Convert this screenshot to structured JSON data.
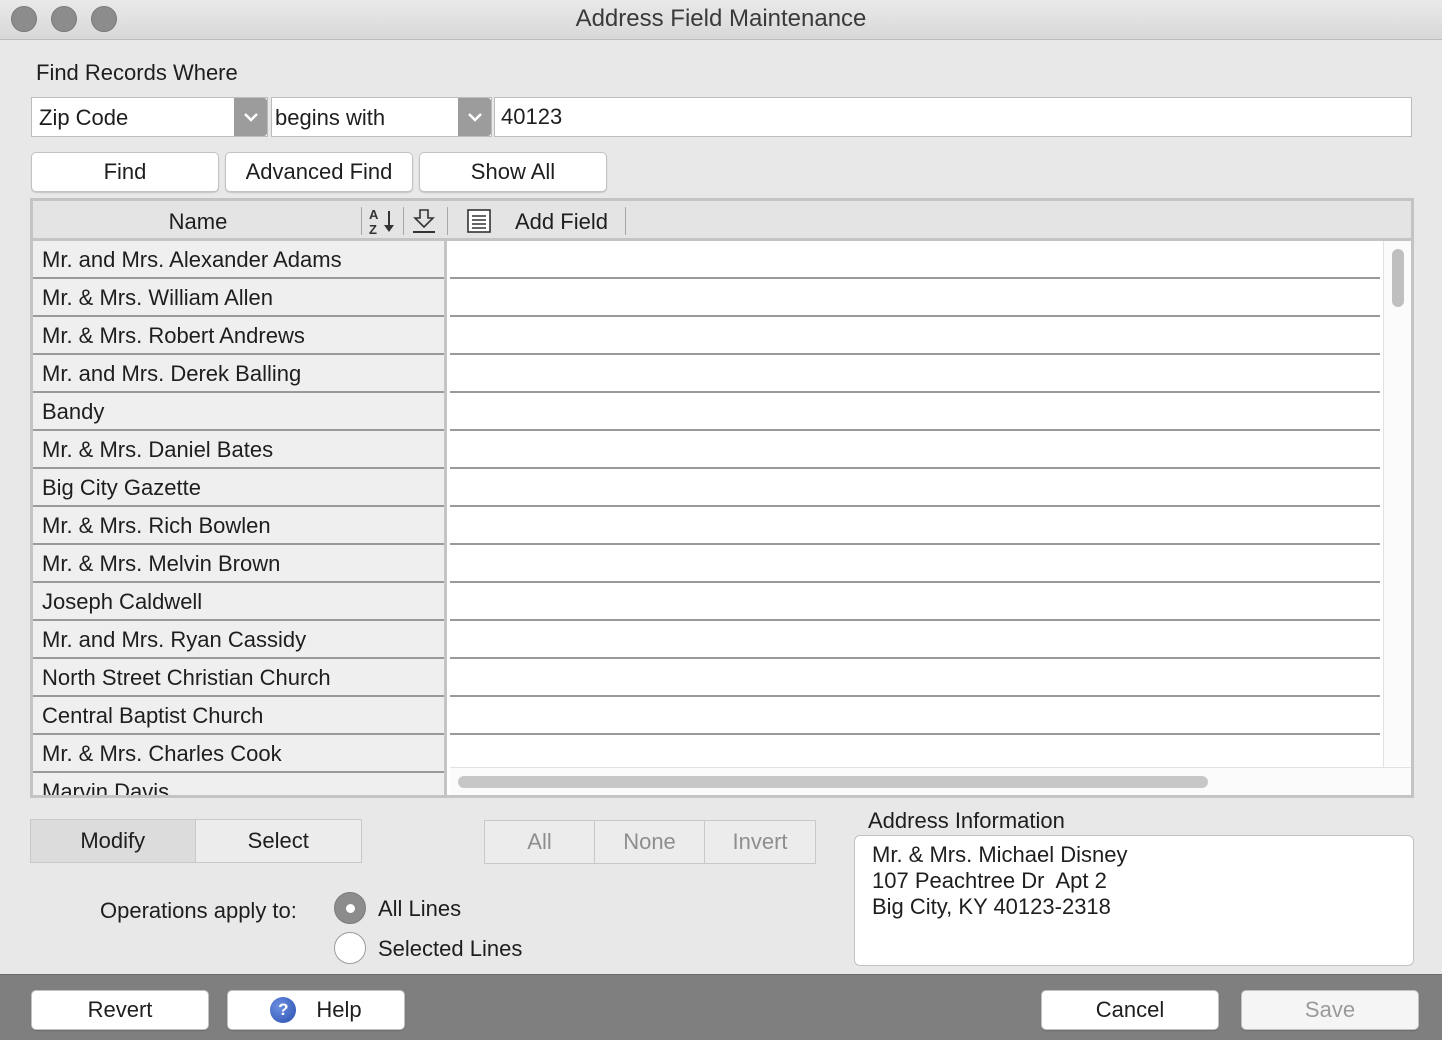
{
  "window": {
    "title": "Address Field Maintenance"
  },
  "find": {
    "heading": "Find Records Where",
    "field_select": "Zip Code",
    "operator_select": "begins with",
    "value": "40123",
    "find_label": "Find",
    "advanced_label": "Advanced Find",
    "show_all_label": "Show All"
  },
  "grid": {
    "name_header": "Name",
    "add_field_label": "Add Field",
    "names": [
      "Mr. and Mrs. Alexander Adams",
      "Mr. & Mrs. William Allen",
      "Mr. & Mrs. Robert Andrews",
      "Mr. and Mrs. Derek Balling",
      "Bandy",
      "Mr. & Mrs. Daniel Bates",
      "Big City Gazette",
      "Mr. & Mrs. Rich Bowlen",
      "Mr. & Mrs. Melvin Brown",
      "Joseph Caldwell",
      "Mr. and Mrs. Ryan Cassidy",
      "North Street Christian Church",
      "Central Baptist Church",
      "Mr. & Mrs. Charles Cook",
      "Marvin Davis"
    ]
  },
  "mode": {
    "modify_label": "Modify",
    "select_label": "Select",
    "active": "Modify"
  },
  "selection": {
    "all_label": "All",
    "none_label": "None",
    "invert_label": "Invert"
  },
  "operations": {
    "label": "Operations apply to:",
    "all_lines_label": "All Lines",
    "selected_lines_label": "Selected Lines",
    "selected": "All Lines"
  },
  "address": {
    "heading": "Address Information",
    "line1": "Mr. & Mrs. Michael Disney",
    "line2": "107 Peachtree Dr  Apt 2",
    "line3": "Big City, KY 40123-2318"
  },
  "footer": {
    "revert_label": "Revert",
    "help_label": "Help",
    "cancel_label": "Cancel",
    "save_label": "Save"
  },
  "icons": {
    "sort": "sort-az-icon",
    "move_down": "move-down-icon",
    "add_field": "list-icon",
    "help": "help-icon",
    "dropdown": "chevron-down-icon"
  }
}
